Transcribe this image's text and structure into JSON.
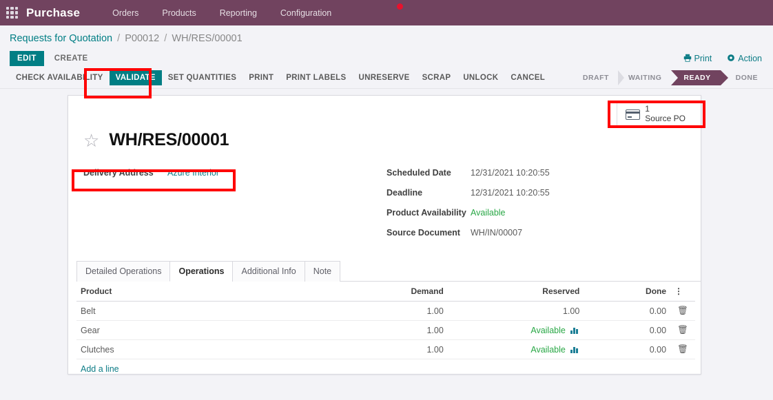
{
  "navbar": {
    "apps_icon": "apps-grid-icon",
    "brand": "Purchase",
    "menu": [
      "Orders",
      "Products",
      "Reporting",
      "Configuration"
    ]
  },
  "breadcrumb": {
    "root": "Requests for Quotation",
    "sep": "/",
    "middle": "P00012",
    "current": "WH/RES/00001"
  },
  "actions": {
    "edit": "EDIT",
    "create": "CREATE",
    "print": "Print",
    "action": "Action",
    "print_icon": "printer-icon",
    "action_icon": "gear-icon"
  },
  "toolbar": {
    "buttons": [
      "CHECK AVAILABILITY",
      "VALIDATE",
      "SET QUANTITIES",
      "PRINT",
      "PRINT LABELS",
      "UNRESERVE",
      "SCRAP",
      "UNLOCK",
      "CANCEL"
    ],
    "primary_index": 1
  },
  "status": {
    "stages": [
      "DRAFT",
      "WAITING",
      "READY",
      "DONE"
    ],
    "active": "READY"
  },
  "stat_button": {
    "icon": "credit-card-icon",
    "count": "1",
    "label": "Source PO"
  },
  "record": {
    "star_icon": "star-icon",
    "title": "WH/RES/00001"
  },
  "fields": {
    "left": [
      {
        "label": "Delivery Address",
        "value": "Azure Interior",
        "style": "link"
      }
    ],
    "right": [
      {
        "label": "Scheduled Date",
        "value": "12/31/2021 10:20:55",
        "style": "plain"
      },
      {
        "label": "Deadline",
        "value": "12/31/2021 10:20:55",
        "style": "plain"
      },
      {
        "label": "Product Availability",
        "value": "Available",
        "style": "green"
      },
      {
        "label": "Source Document",
        "value": "WH/IN/00007",
        "style": "plain"
      }
    ]
  },
  "tabs": {
    "items": [
      "Detailed Operations",
      "Operations",
      "Additional Info",
      "Note"
    ],
    "active": "Operations"
  },
  "table": {
    "headers": [
      "Product",
      "Demand",
      "Reserved",
      "Done"
    ],
    "options_icon": "options-dots-icon",
    "rows": [
      {
        "product": "Belt",
        "demand": "1.00",
        "reserved": "1.00",
        "reserved_style": "plain",
        "done": "0.00",
        "delete_icon": "trash-icon"
      },
      {
        "product": "Gear",
        "demand": "1.00",
        "reserved": "Available",
        "reserved_style": "available",
        "done": "0.00",
        "delete_icon": "trash-icon"
      },
      {
        "product": "Clutches",
        "demand": "1.00",
        "reserved": "Available",
        "reserved_style": "available",
        "done": "0.00",
        "delete_icon": "trash-icon"
      }
    ],
    "add_line": "Add a line",
    "forecast_icon": "forecast-chart-icon"
  },
  "colors": {
    "navbar": "#71435f",
    "accent_teal": "#017e84",
    "link": "#0d7c86",
    "available_green": "#28a745",
    "annotation_red": "#ff0000",
    "page_bg": "#f3f3f7"
  }
}
